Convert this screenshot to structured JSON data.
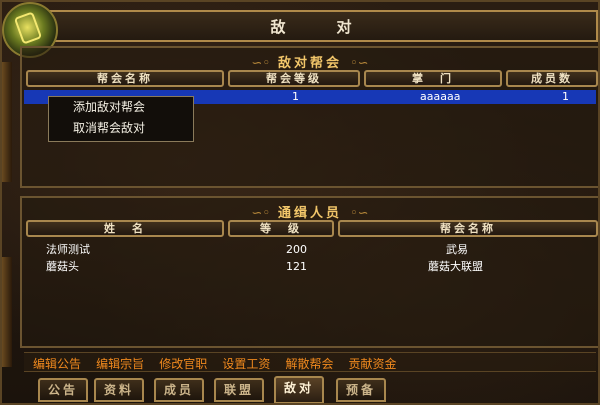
{
  "window": {
    "title": "敌　对"
  },
  "enemy_guilds": {
    "section_title": "敌对帮会",
    "columns": [
      "帮会名称",
      "帮会等级",
      "掌　门",
      "成员数"
    ],
    "rows": [
      {
        "name": "",
        "level": "1",
        "leader": "aaaaaa",
        "members": "1"
      }
    ]
  },
  "context_menu": {
    "items": [
      "添加敌对帮会",
      "取消帮会敌对"
    ]
  },
  "wanted": {
    "section_title": "通缉人员",
    "columns": [
      "姓　名",
      "等　级",
      "帮会名称"
    ],
    "rows": [
      {
        "name": "法师测试",
        "level": "200",
        "guild": "武易"
      },
      {
        "name": "蘑菇头",
        "level": "121",
        "guild": "蘑菇大联盟"
      }
    ]
  },
  "actions": [
    "编辑公告",
    "编辑宗旨",
    "修改官职",
    "设置工资",
    "解散帮会",
    "贡献资金"
  ],
  "tabs": [
    {
      "label": "公告",
      "active": false
    },
    {
      "label": "资料",
      "active": false
    },
    {
      "label": "成员",
      "active": false
    },
    {
      "label": "联盟",
      "active": false
    },
    {
      "label": "敌对",
      "active": true
    },
    {
      "label": "预备",
      "active": false
    }
  ]
}
